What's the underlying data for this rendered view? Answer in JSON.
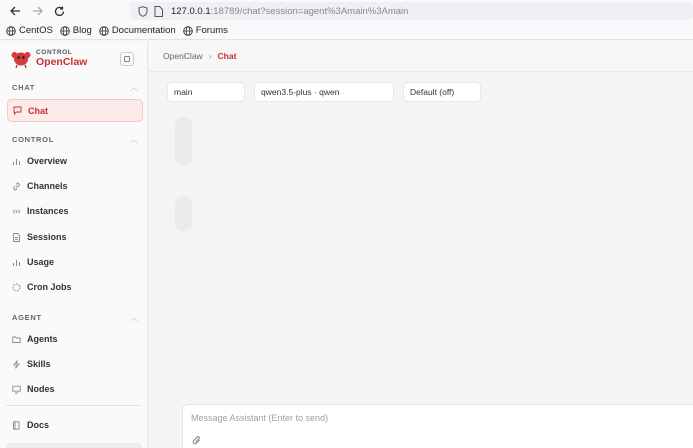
{
  "browser": {
    "url_host": "127.0.0.1",
    "url_rest": ":18789/chat?session=agent%3Amain%3Amain",
    "bookmarks": [
      "CentOS",
      "Blog",
      "Documentation",
      "Forums"
    ]
  },
  "brand": {
    "subtitle": "CONTROL",
    "name": "OpenClaw"
  },
  "sidebar": {
    "sections": [
      {
        "title": "CHAT",
        "items": [
          {
            "label": "Chat",
            "icon": "chat-icon",
            "active": true
          }
        ]
      },
      {
        "title": "CONTROL",
        "items": [
          {
            "label": "Overview",
            "icon": "bar-chart-icon"
          },
          {
            "label": "Channels",
            "icon": "link-icon"
          },
          {
            "label": "Instances",
            "icon": "radio-icon"
          },
          {
            "label": "Sessions",
            "icon": "document-icon"
          },
          {
            "label": "Usage",
            "icon": "bar-chart-icon"
          },
          {
            "label": "Cron Jobs",
            "icon": "loader-icon"
          }
        ]
      },
      {
        "title": "AGENT",
        "items": [
          {
            "label": "Agents",
            "icon": "folder-icon"
          },
          {
            "label": "Skills",
            "icon": "zap-icon"
          },
          {
            "label": "Nodes",
            "icon": "monitor-icon"
          }
        ]
      }
    ],
    "docs_label": "Docs"
  },
  "breadcrumb": {
    "root": "OpenClaw",
    "separator": "›",
    "current": "Chat"
  },
  "pills": {
    "session": "main",
    "model": "qwen3.5-plus · qwen",
    "thinking": "Default (off)"
  },
  "composer": {
    "placeholder": "Message Assistant (Enter to send)"
  },
  "colors": {
    "accent": "#c53030",
    "active_bg": "#fdebe9"
  }
}
